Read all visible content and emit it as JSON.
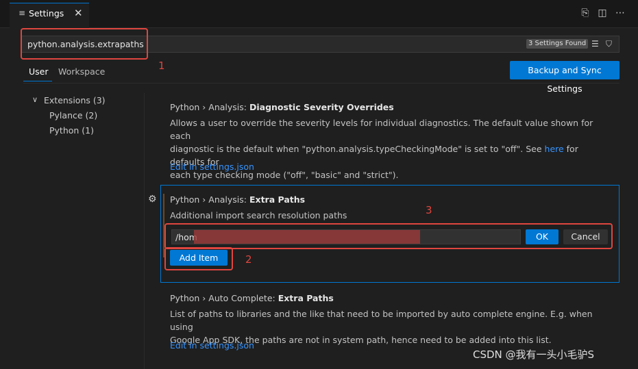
{
  "tab": {
    "icon": "settings-lines-icon",
    "title": "Settings",
    "close": "✕"
  },
  "actions": [
    {
      "name": "open-settings-json-icon",
      "glyph": "⎘"
    },
    {
      "name": "split-editor-icon",
      "glyph": "◫"
    },
    {
      "name": "more-actions-icon",
      "glyph": "⋯"
    }
  ],
  "search": {
    "value": "python.analysis.extrapaths",
    "found": "3 Settings Found"
  },
  "scopes": {
    "user": "User",
    "workspace": "Workspace"
  },
  "sync_button": "Backup and Sync Settings",
  "toc": {
    "extensions": "Extensions (3)",
    "pylance": "Pylance (2)",
    "python": "Python (1)"
  },
  "settings": [
    {
      "prefix": "Python › Analysis: ",
      "name": "Diagnostic Severity Overrides",
      "desc_line1": "Allows a user to override the severity levels for individual diagnostics. The default value shown for each",
      "desc_line2_a": "diagnostic is the default when \"python.analysis.typeCheckingMode\" is set to \"off\". See ",
      "desc_link": "here",
      "desc_line2_b": " for defaults for",
      "desc_line3": "each type checking mode (\"off\", \"basic\" and \"strict\").",
      "edit_link": "Edit in settings.json"
    },
    {
      "prefix": "Python › Analysis: ",
      "name": "Extra Paths",
      "desc": "Additional import search resolution paths",
      "input_value": "/hom",
      "ok": "OK",
      "cancel": "Cancel",
      "add": "Add Item"
    },
    {
      "prefix": "Python › Auto Complete: ",
      "name": "Extra Paths",
      "desc_line1": "List of paths to libraries and the like that need to be imported by auto complete engine. E.g. when using",
      "desc_line2": "Google App SDK, the paths are not in system path, hence need to be added into this list.",
      "edit_link": "Edit in settings.json"
    }
  ],
  "annotations": {
    "n1": "1",
    "n2": "2",
    "n3": "3"
  },
  "watermark": "CSDN @我有一头小毛驴S",
  "colors": {
    "accent": "#0078d4",
    "annotation_red": "#e0463f",
    "background": "#1f1f1f"
  }
}
